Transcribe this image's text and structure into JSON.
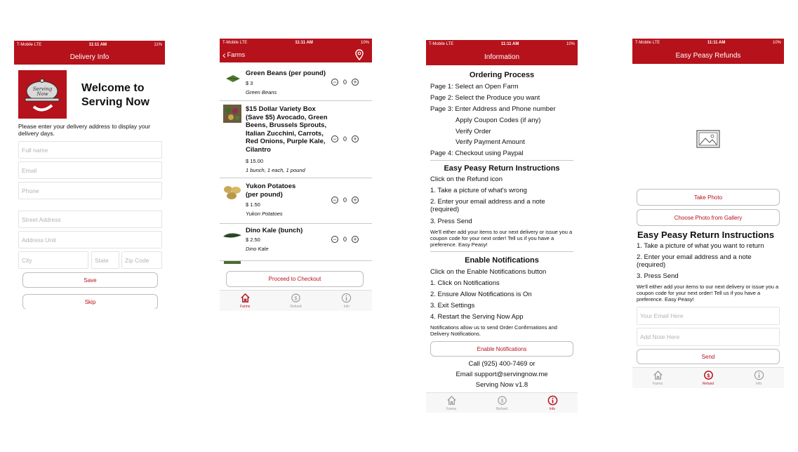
{
  "status": {
    "carrier": "T-Mobile LTE",
    "time": "11:11 AM",
    "battery1": "11%",
    "battery2": "10%"
  },
  "screen1": {
    "title": "Delivery Info",
    "logo_text": "Serving Now",
    "welcome": "Welcome to Serving Now",
    "instructions": "Please enter your delivery address to display your delivery days.",
    "placeholders": {
      "full_name": "Full name",
      "email": "Email",
      "phone": "Phone",
      "street": "Street Address",
      "unit": "Address Unit",
      "city": "City",
      "state": "State",
      "zip": "Zip Code"
    },
    "save": "Save",
    "skip": "Skip"
  },
  "screen2": {
    "back": "Farms",
    "products": [
      {
        "name": "Green Beans (per pound)",
        "price": "$ 3",
        "desc": "Green Beans",
        "qty": "0"
      },
      {
        "name": "$15 Dollar Variety Box (Save $5) Avocado, Green Beens, Brussels Sprouts, Italian Zucchini, Carrots, Red Onions, Purple Kale, Cilantro",
        "price": "$ 15.00",
        "desc": "1 bunch, 1 each, 1 pound",
        "qty": "0"
      },
      {
        "name": "Yukon Potatoes (per pound)",
        "price": "$ 1.50",
        "desc": "Yukon Potatoes",
        "qty": "0"
      },
      {
        "name": "Dino Kale (bunch)",
        "price": "$ 2.50",
        "desc": "Dino Kale",
        "qty": "0"
      }
    ],
    "checkout": "Proceed to Checkout"
  },
  "screen3": {
    "title": "Information",
    "ordering_header": "Ordering Process",
    "ordering_lines": [
      "Page 1: Select an Open Farm",
      "Page 2: Select the Produce you want",
      "Page 3: Enter Address and Phone number",
      "Apply Coupon Codes (if any)",
      "Verify Order",
      "Verify Payment Amount",
      "Page 4: Checkout using Paypal"
    ],
    "return_header": "Easy Peasy Return Instructions",
    "return_lines": [
      "Click on the Refund icon",
      "1. Take a picture of what's wrong",
      "2. Enter your email address and a note (required)",
      "3. Press Send"
    ],
    "return_note": "We'll either add your items to our next delivery or issue you a coupon code for your next order! Tell us if you have a preference. Easy Peasy!",
    "notif_header": "Enable Notifications",
    "notif_lines": [
      "Click on the Enable Notifications button",
      "1. Click on Notifications",
      "2. Ensure Allow Notifications is On",
      "3. Exit Settings",
      "4. Restart the Serving Now App"
    ],
    "notif_note": "Notifications allow us to send Order Confirmations and Delivery Notifications.",
    "enable_button": "Enable Notifications",
    "contact_lines": [
      "Call (925) 400-7469 or",
      "Email support@servingnow.me",
      "Serving Now v1.8"
    ]
  },
  "screen4": {
    "title": "Easy Peasy Refunds",
    "take_photo": "Take Photo",
    "choose_photo": "Choose Photo from Gallery",
    "header": "Easy Peasy Return Instructions",
    "lines": [
      "1. Take a picture of what you want to return",
      "2. Enter your email address and a note (required)",
      "3. Press Send"
    ],
    "note": "We'll either add your items to our next delivery or issue you a coupon code for your next order! Tell us if you have a preference. Easy Peasy!",
    "email_placeholder": "Your Email Here",
    "note_placeholder": "Add Note Here",
    "send": "Send"
  },
  "tabs": {
    "farms": "Farms",
    "refund": "Refund",
    "info": "Info"
  },
  "colors": {
    "accent": "#b5121b",
    "inactive": "#999999"
  }
}
